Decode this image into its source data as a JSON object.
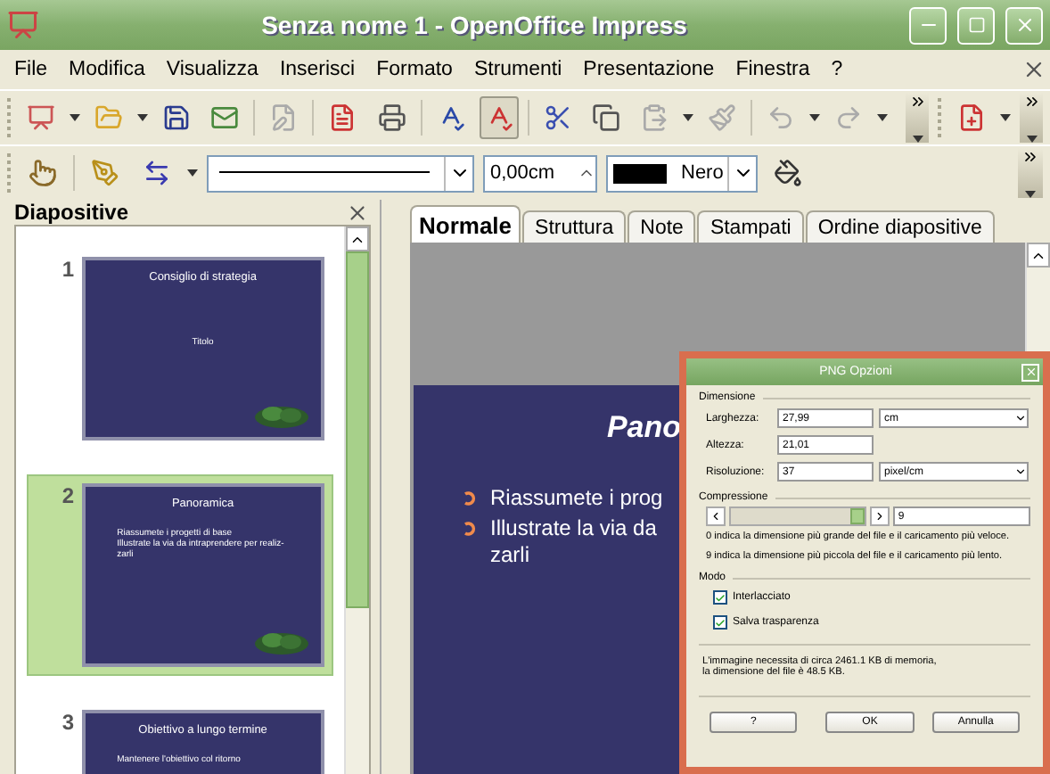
{
  "window": {
    "title": "Senza nome 1 - OpenOffice Impress"
  },
  "menu": [
    {
      "label": "File"
    },
    {
      "label": "Modifica"
    },
    {
      "label": "Visualizza"
    },
    {
      "label": "Inserisci"
    },
    {
      "label": "Formato"
    },
    {
      "label": "Strumenti"
    },
    {
      "label": "Presentazione"
    },
    {
      "label": "Finestra"
    },
    {
      "label": "?"
    }
  ],
  "line_toolbar": {
    "line_width": "0,00cm",
    "color_name": "Nero",
    "color": "#000000"
  },
  "slides_panel": {
    "title": "Diapositive"
  },
  "slides": [
    {
      "number": "1",
      "selected": false,
      "title": "Consiglio di strategia",
      "subtitle": "Titolo",
      "shrub": true
    },
    {
      "number": "2",
      "selected": true,
      "title": "Panoramica",
      "shrub": true,
      "bullets": [
        "Riassumete i progetti di base",
        "Illustrate la via da intraprendere per realiz-\nzarli"
      ]
    },
    {
      "number": "3",
      "selected": false,
      "title": "Obiettivo a lungo termine",
      "bullets": [
        "Mantenere l'obiettivo col ritorno"
      ]
    }
  ],
  "tabs": [
    {
      "label": "Normale",
      "selected": true
    },
    {
      "label": "Struttura",
      "selected": false
    },
    {
      "label": "Note",
      "selected": false
    },
    {
      "label": "Stampati",
      "selected": false
    },
    {
      "label": "Ordine diapositive",
      "selected": false
    }
  ],
  "slide": {
    "title": "Pano",
    "bullets": [
      "Riassumete i prog",
      "Illustrate la via da\nzarli"
    ]
  },
  "dialog": {
    "title": "PNG Opzioni",
    "size_section": "Dimensione",
    "fields": [
      {
        "label": "Larghezza:",
        "value": "27,99",
        "unit": "cm"
      },
      {
        "label": "Altezza:",
        "value": "21,01"
      },
      {
        "label": "Risoluzione:",
        "value": "37",
        "unit": "pixel/cm"
      }
    ],
    "compression_section": "Compressione",
    "compression": {
      "level": 1.0,
      "value": "9"
    },
    "notes": [
      "0 indica la dimensione più grande del file e il caricamento più veloce.",
      "9 indica la dimensione più piccola del file e il caricamento più lento."
    ],
    "mode_section": "Modo",
    "options": [
      {
        "label": "Interlacciato",
        "checked": true
      },
      {
        "label": "Salva trasparenza",
        "checked": true
      }
    ],
    "info": "L'immagine necessita di circa 2461.1 KB di memoria,\n la dimensione del file è 48.5 KB.",
    "buttons": [
      "?",
      "OK",
      "Annulla"
    ]
  }
}
